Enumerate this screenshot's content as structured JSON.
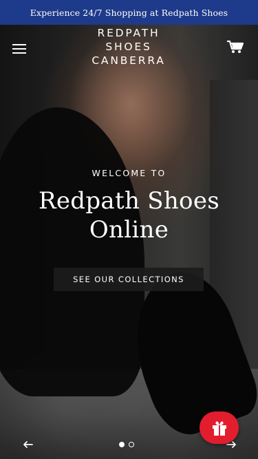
{
  "announcement": {
    "text": "Experience 24/7 Shopping at Redpath Shoes",
    "background": "#1e3a8a"
  },
  "header": {
    "logo_lines": [
      "REDPATH",
      "SHOES",
      "CANBERRA"
    ],
    "menu_icon": "hamburger-icon",
    "cart_icon": "cart-icon"
  },
  "hero": {
    "subheading": "WELCOME TO",
    "heading_line1": "Redpath Shoes",
    "heading_line2": "Online",
    "cta_label": "SEE OUR COLLECTIONS"
  },
  "slideshow": {
    "prev_icon": "arrow-left-icon",
    "next_icon": "arrow-right-icon",
    "slide_count": 2,
    "active_slide": 1
  },
  "gift_button": {
    "icon": "gift-icon",
    "color": "#e11d2e"
  }
}
